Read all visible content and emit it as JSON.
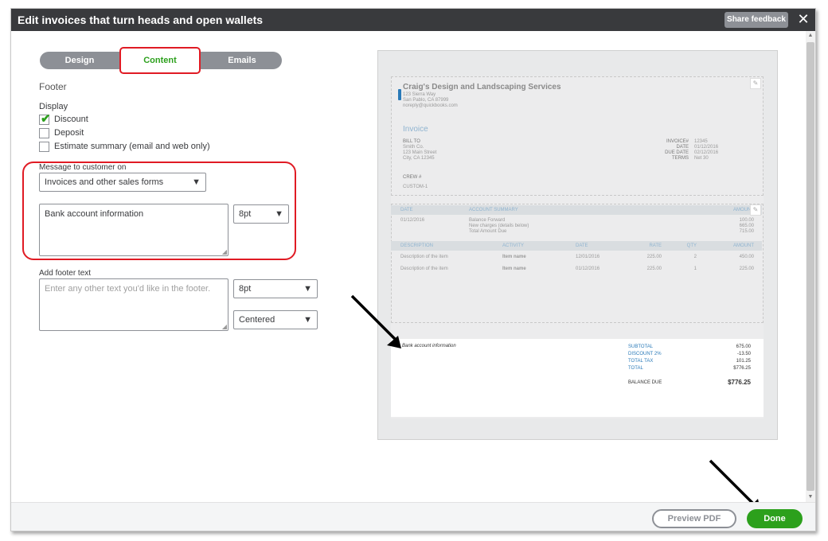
{
  "window": {
    "title": "Edit invoices that turn heads and open wallets",
    "share_feedback": "Share feedback",
    "close": "✕"
  },
  "tabs": {
    "design": "Design",
    "content": "Content",
    "emails": "Emails"
  },
  "section": {
    "footer": "Footer",
    "display": "Display"
  },
  "display_options": [
    {
      "label": "Discount",
      "checked": true
    },
    {
      "label": "Deposit",
      "checked": false
    },
    {
      "label": "Estimate summary (email and web only)",
      "checked": false
    }
  ],
  "message": {
    "label": "Message to customer on",
    "target": "Invoices and other sales forms",
    "text": "Bank account information",
    "font_size": "8pt"
  },
  "footer_text": {
    "label": "Add footer text",
    "placeholder": "Enter any other text you'd like in the footer.",
    "font_size": "8pt",
    "alignment": "Centered"
  },
  "preview": {
    "company": "Craig's Design and Landscaping Services",
    "address1": "123 Sierra Way",
    "address2": "San Pablo, CA 87999",
    "email": "noreply@quickbooks.com",
    "doc_title": "Invoice",
    "bill_to_label": "BILL TO",
    "bill_to": [
      "Smith Co.",
      "123 Main Street",
      "City, CA 12345"
    ],
    "meta_labels": [
      "INVOICE#",
      "DATE",
      "DUE DATE",
      "TERMS"
    ],
    "meta_values": [
      "12345",
      "01/12/2016",
      "02/12/2016",
      "Net 30"
    ],
    "crew_label": "CREW #",
    "crew_value": "CUSTOM-1",
    "summary_headers": {
      "date": "DATE",
      "summary": "ACCOUNT SUMMARY",
      "amount": "AMOUNT"
    },
    "summary_date": "01/12/2016",
    "summary_lines": [
      "Balance Forward",
      "New charges (details below)",
      "Total Amount Due"
    ],
    "summary_amounts": [
      "100.00",
      "665.00",
      "715.00"
    ],
    "item_headers": [
      "DESCRIPTION",
      "ACTIVITY",
      "DATE",
      "RATE",
      "QTY",
      "AMOUNT"
    ],
    "items": [
      [
        "Description of the item",
        "Item name",
        "12/01/2016",
        "225.00",
        "2",
        "450.00"
      ],
      [
        "Description of the item",
        "Item name",
        "01/12/2016",
        "225.00",
        "1",
        "225.00"
      ]
    ],
    "footer_message": "Bank account information",
    "totals_labels": [
      "SUBTOTAL",
      "DISCOUNT 2%",
      "TOTAL TAX",
      "TOTAL"
    ],
    "totals_values": [
      "675.00",
      "-13.50",
      "101.25",
      "$776.25"
    ],
    "balance_label": "BALANCE DUE",
    "balance_value": "$776.25"
  },
  "actions": {
    "preview_pdf": "Preview PDF",
    "done": "Done"
  },
  "colors": {
    "accent_green": "#2ca01c",
    "annotation_red": "#e01b24",
    "titlebar": "#393a3d"
  }
}
